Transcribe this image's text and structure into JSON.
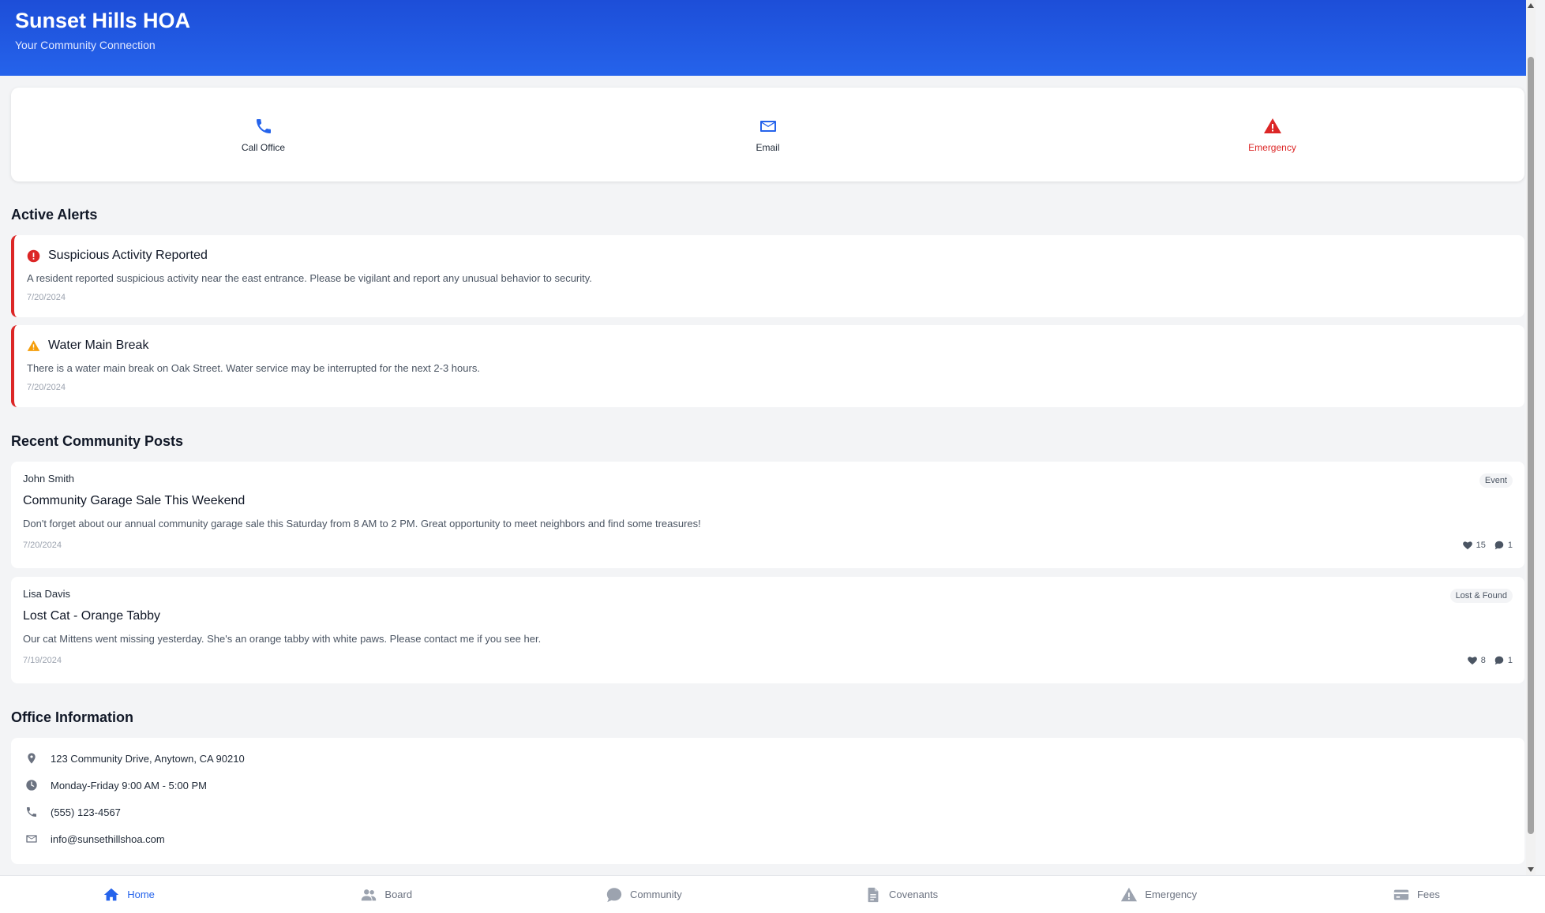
{
  "header": {
    "title": "Sunset Hills HOA",
    "subtitle": "Your Community Connection"
  },
  "quick_actions": [
    {
      "label": "Call Office",
      "icon": "phone-icon"
    },
    {
      "label": "Email",
      "icon": "mail-icon"
    },
    {
      "label": "Emergency",
      "icon": "warning-triangle-icon"
    }
  ],
  "alerts": {
    "title": "Active Alerts",
    "items": [
      {
        "title": "Suspicious Activity Reported",
        "message": "A resident reported suspicious activity near the east entrance. Please be vigilant and report any unusual behavior to security.",
        "date": "7/20/2024",
        "icon": "alert-circle-icon"
      },
      {
        "title": "Water Main Break",
        "message": "There is a water main break on Oak Street. Water service may be interrupted for the next 2-3 hours.",
        "date": "7/20/2024",
        "icon": "warning-triangle-icon"
      }
    ]
  },
  "posts": {
    "title": "Recent Community Posts",
    "items": [
      {
        "author": "John Smith",
        "tag": "Event",
        "title": "Community Garage Sale This Weekend",
        "body": "Don't forget about our annual community garage sale this Saturday from 8 AM to 2 PM. Great opportunity to meet neighbors and find some treasures!",
        "date": "7/20/2024",
        "likes": "15",
        "comments": "1"
      },
      {
        "author": "Lisa Davis",
        "tag": "Lost & Found",
        "title": "Lost Cat - Orange Tabby",
        "body": "Our cat Mittens went missing yesterday. She's an orange tabby with white paws. Please contact me if you see her.",
        "date": "7/19/2024",
        "likes": "8",
        "comments": "1"
      }
    ]
  },
  "office": {
    "title": "Office Information",
    "address": "123 Community Drive, Anytown, CA 90210",
    "hours": "Monday-Friday 9:00 AM - 5:00 PM",
    "phone": "(555) 123-4567",
    "email": "info@sunsethillshoa.com"
  },
  "nav": [
    {
      "label": "Home",
      "icon": "home-icon",
      "active": true
    },
    {
      "label": "Board",
      "icon": "users-icon",
      "active": false
    },
    {
      "label": "Community",
      "icon": "chat-bubble-icon",
      "active": false
    },
    {
      "label": "Covenants",
      "icon": "document-icon",
      "active": false
    },
    {
      "label": "Emergency",
      "icon": "warning-triangle-icon",
      "active": false
    },
    {
      "label": "Fees",
      "icon": "credit-card-icon",
      "active": false
    }
  ],
  "colors": {
    "primary": "#2563eb",
    "danger": "#dc2626",
    "warning": "#f59e0b"
  }
}
